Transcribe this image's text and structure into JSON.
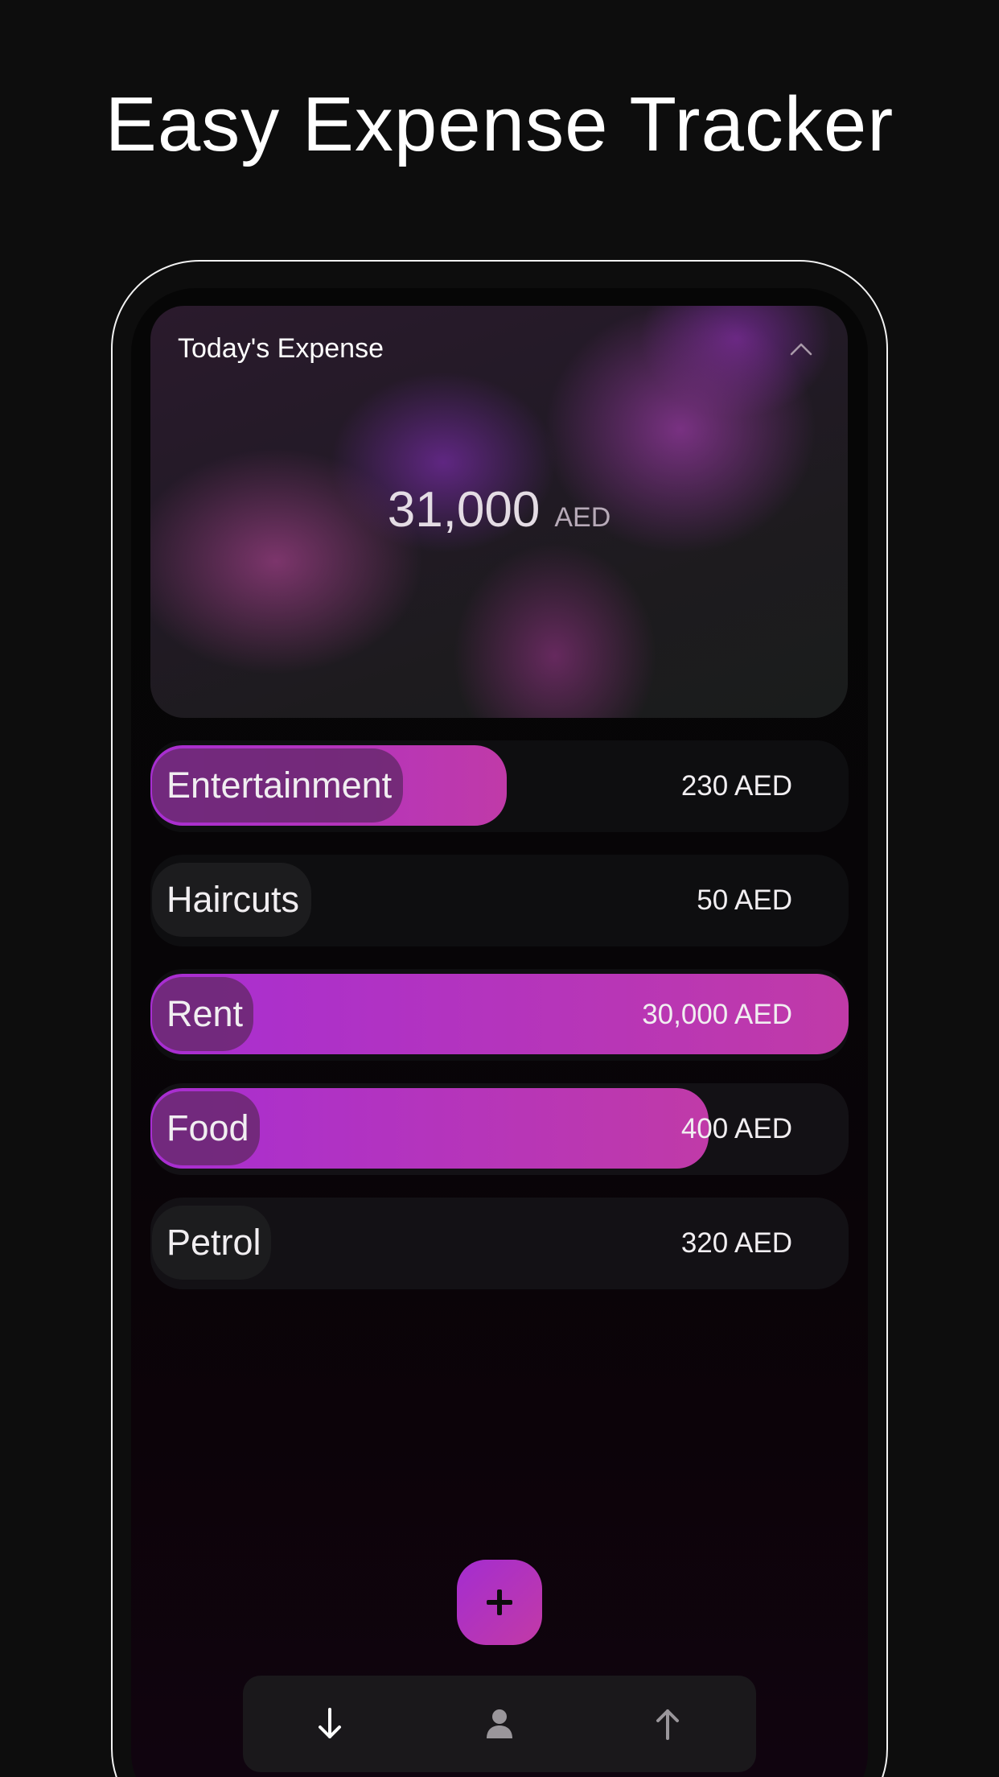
{
  "headline": "Easy Expense Tracker",
  "expense_card": {
    "title": "Today's Expense",
    "total_amount": "31,000",
    "currency": "AED",
    "collapse_icon": "chevron-up-icon"
  },
  "categories": [
    {
      "name": "Entertainment",
      "amount": "230 AED",
      "fill_fraction": 0.51
    },
    {
      "name": "Haircuts",
      "amount": "50 AED",
      "fill_fraction": 0
    },
    {
      "name": "Rent",
      "amount": "30,000 AED",
      "fill_fraction": 1.0
    },
    {
      "name": "Food",
      "amount": "400 AED",
      "fill_fraction": 0.8
    },
    {
      "name": "Petrol",
      "amount": "320 AED",
      "fill_fraction": 0
    }
  ],
  "add_button": {
    "icon": "plus-icon"
  },
  "bottom_nav": {
    "items": [
      {
        "icon": "arrow-down-icon"
      },
      {
        "icon": "person-icon"
      },
      {
        "icon": "arrow-up-icon"
      }
    ]
  },
  "colors": {
    "background": "#0d0d0d",
    "accent_start": "#a82ed2",
    "accent_end": "#c03aa8",
    "frame": "#f2f2f2"
  }
}
